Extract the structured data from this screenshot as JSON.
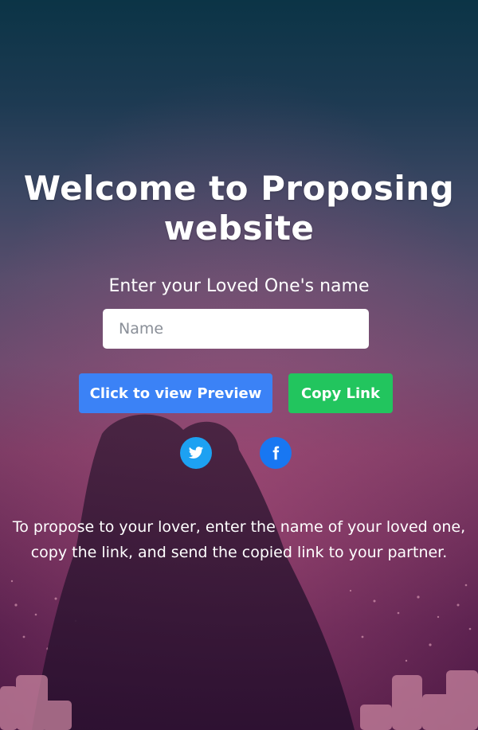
{
  "page": {
    "title": "Welcome to Proposing website",
    "prompt": "Enter your Loved One's name",
    "name_input": {
      "value": "",
      "placeholder": "Name"
    },
    "buttons": {
      "preview_label": "Click to view Preview",
      "copy_label": "Copy Link"
    },
    "social": [
      {
        "icon": "twitter-icon",
        "color": "#1da1f2"
      },
      {
        "icon": "facebook-icon",
        "color": "#1877f2"
      }
    ],
    "instructions": "To propose to your lover, enter the name of your loved one, copy the link, and send the copied link to your partner."
  },
  "colors": {
    "preview_button": "#3b82f6",
    "copy_button": "#22c55e",
    "text": "#ffffff"
  }
}
